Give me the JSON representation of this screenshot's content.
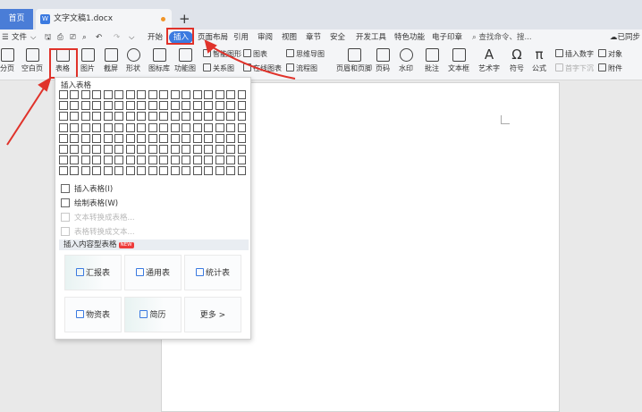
{
  "tabs": {
    "home": "首页",
    "document": "文字文稿1.docx",
    "new_tab": "+"
  },
  "menu": {
    "file": "文件",
    "items": [
      "开始",
      "插入",
      "页面布局",
      "引用",
      "审阅",
      "视图",
      "章节",
      "安全",
      "开发工具",
      "特色功能",
      "电子印章"
    ],
    "search": "查找命令、搜...",
    "sync": "已同步"
  },
  "ribbon": {
    "page_break": "分页",
    "blank_page": "空白页",
    "table": "表格",
    "picture": "图片",
    "screenshot": "截屏",
    "shape": "形状",
    "icon_lib": "图标库",
    "function_chart": "功能图",
    "smart_art": "智能图形",
    "chart": "图表",
    "mind_map": "思维导图",
    "relation": "关系图",
    "online_chart": "在线图表",
    "flow_chart": "流程图",
    "header_footer": "页眉和页脚",
    "page_number": "页码",
    "watermark": "水印",
    "comment": "批注",
    "textbox": "文本框",
    "art_text": "艺术字",
    "symbol": "符号",
    "formula": "公式",
    "insert_number": "插入数字",
    "object": "对象",
    "drop_cap": "首字下沉",
    "attachment": "附件"
  },
  "dropdown": {
    "title": "插入表格",
    "grid_rows": 8,
    "grid_cols": 17,
    "items": [
      {
        "label": "插入表格(I)",
        "enabled": true
      },
      {
        "label": "绘制表格(W)",
        "enabled": true
      },
      {
        "label": "文本转换成表格...",
        "enabled": false
      },
      {
        "label": "表格转换成文本...",
        "enabled": false
      }
    ],
    "section": "插入内容型表格",
    "new_badge": "NEW",
    "cards": [
      "汇报表",
      "通用表",
      "统计表",
      "物资表",
      "简历",
      "更多 >"
    ]
  },
  "colors": {
    "accent": "#3b7ae0",
    "highlight": "#e0322a"
  }
}
